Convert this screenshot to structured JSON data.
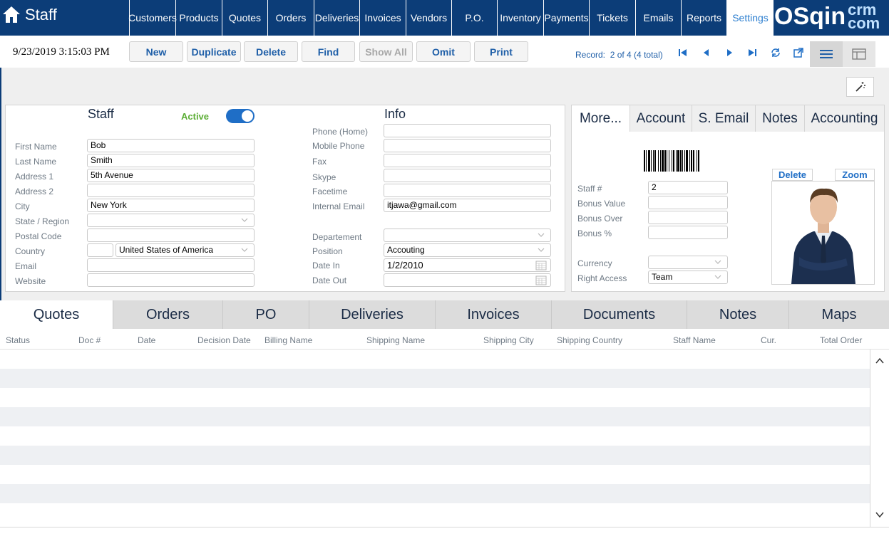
{
  "app": {
    "title": "Staff"
  },
  "nav": {
    "items": [
      {
        "label": "Customers"
      },
      {
        "label": "Products"
      },
      {
        "label": "Quotes"
      },
      {
        "label": "Orders"
      },
      {
        "label": "Deliveries"
      },
      {
        "label": "Invoices"
      },
      {
        "label": "Vendors"
      },
      {
        "label": "P.O."
      },
      {
        "label": "Inventory"
      },
      {
        "label": "Payments"
      },
      {
        "label": "Tickets"
      },
      {
        "label": "Emails"
      },
      {
        "label": "Reports"
      },
      {
        "label": "Settings"
      }
    ],
    "logo_main": "OSqin",
    "logo_sub1": "crm",
    "logo_sub2": "com"
  },
  "toolbar": {
    "datetime": "9/23/2019 3:15:03 PM",
    "buttons": [
      "New",
      "Duplicate",
      "Delete",
      "Find",
      "Show All",
      "Omit",
      "Print"
    ],
    "record_label": "Record:",
    "record_value": "2 of 4 (4 total)"
  },
  "staff": {
    "title": "Staff",
    "active_label": "Active",
    "active_on": true,
    "labels": {
      "first_name": "First Name",
      "last_name": "Last Name",
      "address1": "Address 1",
      "address2": "Address 2",
      "city": "City",
      "state": "State / Region",
      "postal": "Postal Code",
      "country": "Country",
      "email": "Email",
      "website": "Website"
    },
    "values": {
      "first_name": "Bob",
      "last_name": "Smith",
      "address1": "5th Avenue",
      "address2": "",
      "city": "New York",
      "state": "",
      "postal": "",
      "country_code": "",
      "country": "United States of America",
      "email": "",
      "website": ""
    }
  },
  "info": {
    "title": "Info",
    "labels": {
      "phone_home": "Phone (Home)",
      "mobile": "Mobile Phone",
      "fax": "Fax",
      "skype": "Skype",
      "facetime": "Facetime",
      "internal_email": "Internal Email",
      "department": "Departement",
      "position": "Position",
      "date_in": "Date In",
      "date_out": "Date Out"
    },
    "values": {
      "phone_home": "",
      "mobile": "",
      "fax": "",
      "skype": "",
      "facetime": "",
      "internal_email": "itjawa@gmail.com",
      "department": "",
      "position": "Accouting",
      "date_in": "1/2/2010",
      "date_out": ""
    }
  },
  "more": {
    "tabs": [
      "More...",
      "Account",
      "S. Email",
      "Notes",
      "Accounting"
    ],
    "labels": {
      "staff_no": "Staff #",
      "bonus_value": "Bonus Value",
      "bonus_over": "Bonus Over",
      "bonus_pct": "Bonus %",
      "currency": "Currency",
      "right_access": "Right Access"
    },
    "values": {
      "staff_no": "2",
      "bonus_value": "",
      "bonus_over": "",
      "bonus_pct": "",
      "currency": "",
      "right_access": "Team"
    },
    "photo_delete": "Delete",
    "photo_zoom": "Zoom"
  },
  "bottom": {
    "tabs": [
      "Quotes",
      "Orders",
      "PO",
      "Deliveries",
      "Invoices",
      "Documents",
      "Notes",
      "Maps"
    ],
    "columns": [
      "Status",
      "Doc #",
      "Date",
      "Decision Date",
      "Billing Name",
      "Shipping Name",
      "Shipping City",
      "Shipping Country",
      "Staff Name",
      "Cur.",
      "Total Order"
    ]
  },
  "colors": {
    "nav_bg": "#0c3d78",
    "accent": "#1f6ec6",
    "active_green": "#5cae36"
  }
}
